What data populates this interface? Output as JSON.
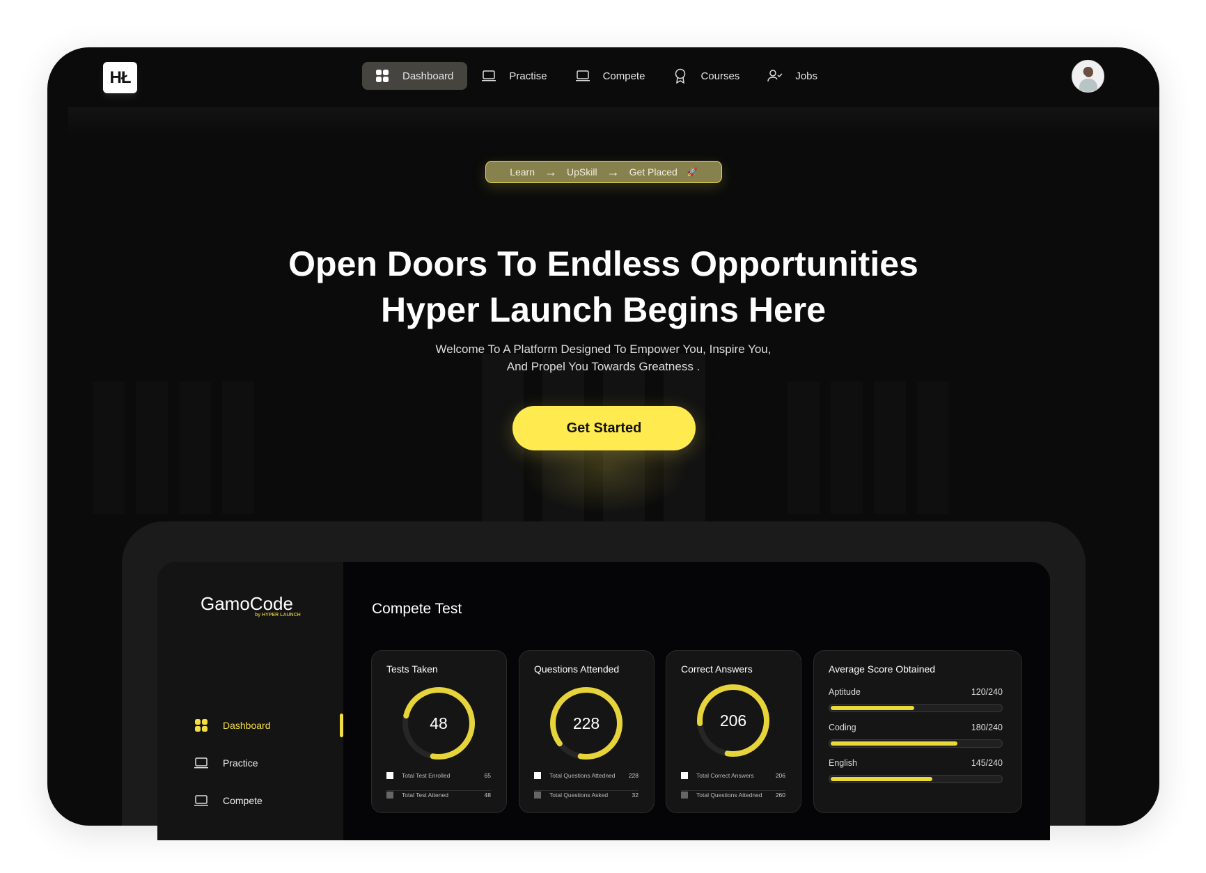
{
  "nav": {
    "logo": "HŁ",
    "items": [
      {
        "label": "Dashboard",
        "icon": "grid-icon",
        "active": true
      },
      {
        "label": "Practise",
        "icon": "laptop-icon",
        "active": false
      },
      {
        "label": "Compete",
        "icon": "laptop-icon",
        "active": false
      },
      {
        "label": "Courses",
        "icon": "award-icon",
        "active": false
      },
      {
        "label": "Jobs",
        "icon": "user-check-icon",
        "active": false
      }
    ]
  },
  "hero": {
    "tagline": [
      "Learn",
      "UpSkill",
      "Get Placed"
    ],
    "tagline_emoji": "🚀",
    "title_line1": "Open Doors To Endless Opportunities",
    "title_line2": "Hyper Launch Begins Here",
    "subtitle_line1": "Welcome To A Platform Designed To Empower You, Inspire You,",
    "subtitle_line2": "And Propel You Towards Greatness .",
    "cta": "Get Started"
  },
  "mock": {
    "brand": "GamoCode",
    "brand_sub": "by HYPER LAUNCH",
    "sidebar": [
      {
        "label": "Dashboard",
        "active": true
      },
      {
        "label": "Practice",
        "active": false
      },
      {
        "label": "Compete",
        "active": false
      }
    ],
    "title": "Compete Test",
    "cards": [
      {
        "title": "Tests Taken",
        "value": "48",
        "progress": 0.74,
        "legend": [
          {
            "label": "Total Test Enrolled",
            "value": "65"
          },
          {
            "label": "Total Test Attened",
            "value": "48"
          }
        ]
      },
      {
        "title": "Questions Attended",
        "value": "228",
        "progress": 0.88,
        "legend": [
          {
            "label": "Total Questions Attedned",
            "value": "228"
          },
          {
            "label": "Total Questions Asked",
            "value": "32"
          }
        ]
      },
      {
        "title": "Correct Answers",
        "value": "206",
        "progress": 0.79,
        "legend": [
          {
            "label": "Total Correct Answers",
            "value": "206"
          },
          {
            "label": "Total Questions Attedned",
            "value": "260"
          }
        ]
      }
    ],
    "scores": {
      "title": "Average Score Obtained",
      "items": [
        {
          "label": "Aptitude",
          "text": "120/240",
          "value": 120,
          "max": 240
        },
        {
          "label": "Coding",
          "text": "180/240",
          "value": 180,
          "max": 240
        },
        {
          "label": "English",
          "text": "145/240",
          "value": 145,
          "max": 240
        }
      ]
    }
  },
  "colors": {
    "accent": "#ffeb4f",
    "ring": "#e6d43a",
    "bg": "#0b0b0b"
  }
}
